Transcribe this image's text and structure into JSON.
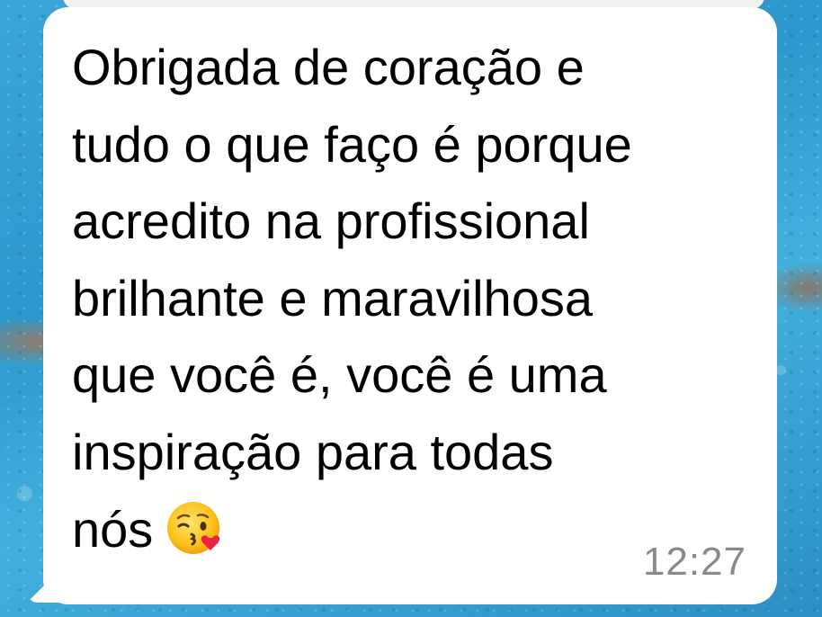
{
  "message": {
    "lines": [
      "Obrigada de coração e",
      "tudo o que faço é porque",
      "acredito na profissional",
      "brilhante e maravilhosa",
      "que você é, você é uma",
      "inspiração para todas",
      "nós"
    ],
    "emoji": "face-blowing-a-kiss",
    "time": "12:27"
  },
  "colors": {
    "bubble": "#ffffff",
    "text": "#000000",
    "timestamp": "#8a8a8a",
    "background": "#2b97cc"
  }
}
